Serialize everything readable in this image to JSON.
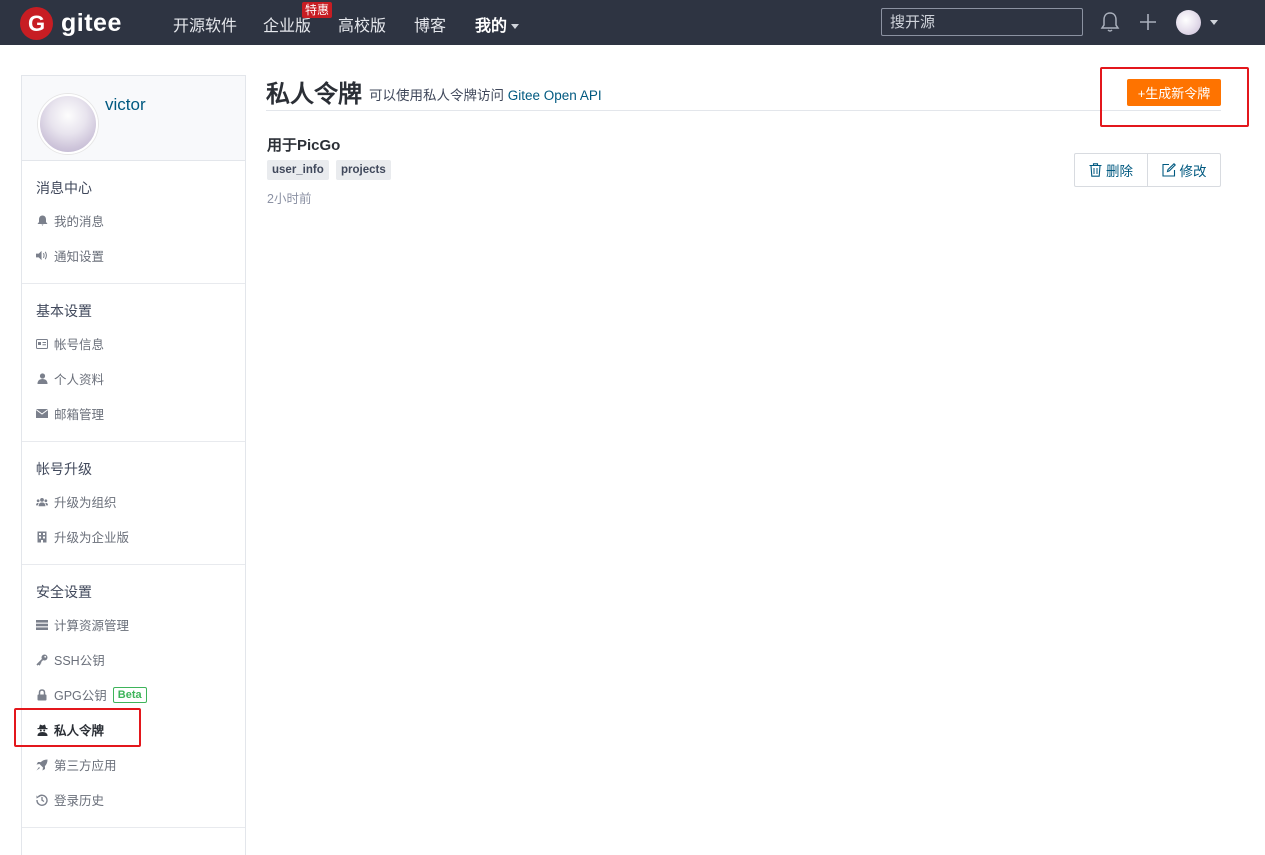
{
  "header": {
    "logo_letter": "G",
    "logo_text": "gitee",
    "nav": [
      "开源软件",
      "企业版",
      "高校版",
      "博客",
      "我的"
    ],
    "nav_badge": "特惠",
    "search_placeholder": "搜开源",
    "icons": [
      "bell-icon",
      "plus-icon",
      "avatar"
    ]
  },
  "sidebar": {
    "username": "victor",
    "groups": [
      {
        "title": "消息中心",
        "items": [
          {
            "label": "我的消息",
            "icon": "bell-icon"
          },
          {
            "label": "通知设置",
            "icon": "volume-icon"
          }
        ]
      },
      {
        "title": "基本设置",
        "items": [
          {
            "label": "帐号信息",
            "icon": "id-card-icon"
          },
          {
            "label": "个人资料",
            "icon": "user-icon"
          },
          {
            "label": "邮箱管理",
            "icon": "envelope-icon"
          }
        ]
      },
      {
        "title": "帐号升级",
        "items": [
          {
            "label": "升级为组织",
            "icon": "users-icon"
          },
          {
            "label": "升级为企业版",
            "icon": "building-icon"
          }
        ]
      },
      {
        "title": "安全设置",
        "items": [
          {
            "label": "计算资源管理",
            "icon": "server-icon"
          },
          {
            "label": "SSH公钥",
            "icon": "key-icon"
          },
          {
            "label": "GPG公钥",
            "icon": "lock-icon",
            "badge": "Beta"
          },
          {
            "label": "私人令牌",
            "icon": "user-secret-icon",
            "active": true
          },
          {
            "label": "第三方应用",
            "icon": "rocket-icon"
          },
          {
            "label": "登录历史",
            "icon": "history-icon"
          }
        ]
      }
    ]
  },
  "main": {
    "title": "私人令牌",
    "desc_prefix": "可以使用私人令牌访问 ",
    "desc_link": "Gitee Open API",
    "new_button": "+生成新令牌",
    "token": {
      "name": "用于PicGo",
      "scopes": [
        "user_info",
        "projects"
      ],
      "time": "2小时前",
      "delete_label": "删除",
      "edit_label": "修改"
    }
  },
  "colors": {
    "topbar": "#2e3442",
    "brand_red": "#c71d23",
    "accent_orange": "#fe7300",
    "link": "#005980",
    "highlight_red": "#e3171c",
    "beta_green": "#3eb45a"
  }
}
